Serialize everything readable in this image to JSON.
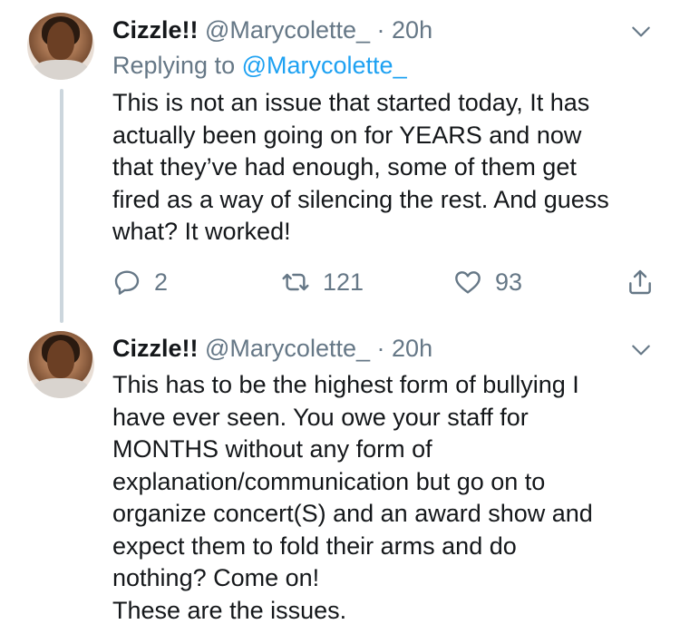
{
  "tweets": [
    {
      "name": "Cizzle!!",
      "handle": "@Marycolette_",
      "separator": "·",
      "time": "20h",
      "replying_prefix": "Replying to",
      "replying_handle": "@Marycolette_",
      "text": [
        "This is not an issue that started today, It has",
        "actually been going on for YEARS and now",
        "that they’ve had enough, some of them get",
        "fired as a way of silencing the rest. And guess",
        "what? It worked!"
      ],
      "actions": {
        "replies": "2",
        "retweets": "121",
        "likes": "93"
      }
    },
    {
      "name": "Cizzle!!",
      "handle": "@Marycolette_",
      "separator": "·",
      "time": "20h",
      "text": [
        "This has to be the highest form of bullying I",
        "have ever seen. You owe your staff for",
        "MONTHS without any form of",
        "explanation/communication but go on to",
        "organize concert(S) and an award show and",
        "expect them to fold their arms and do",
        "nothing? Come on!",
        "These are the issues."
      ]
    }
  ],
  "icons": {
    "reply": "reply-icon",
    "retweet": "retweet-icon",
    "like": "heart-icon",
    "share": "share-icon",
    "menu": "chevron-down-icon"
  },
  "colors": {
    "text": "#14171a",
    "secondary": "#657786",
    "link": "#1da1f2",
    "thread_line": "#ccd6dd"
  }
}
